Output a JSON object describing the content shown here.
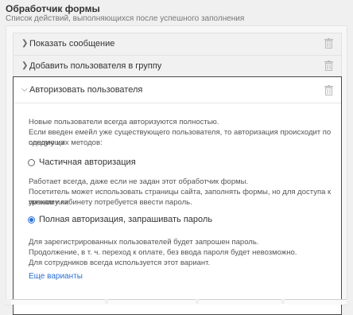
{
  "header": {
    "title": "Обработчик формы",
    "subtitle": "Список действий, выполняющихся после успешного заполнения"
  },
  "actions": [
    {
      "label": "Показать сообщение",
      "expanded": false
    },
    {
      "label": "Добавить пользователя в группу",
      "expanded": false
    },
    {
      "label": "Авторизовать пользователя",
      "expanded": true
    }
  ],
  "auth": {
    "intro_line1": "Новые пользователи всегда авторизуются полностью.",
    "intro_line2": "Если введен емейл уже существующего пользователя, то авторизация происходит по одному из",
    "intro_line3": "следующих методов:",
    "option1_label": "Частичная авторизация",
    "option1_checked": false,
    "option1_desc1": "Работает всегда, даже если не задан этот обработчик формы.",
    "option1_desc2": "Посетитель может использовать страницы сайта, заполнять формы, но для доступа к урокам или",
    "option1_desc3": "личному кабинету потребуется ввести пароль.",
    "option2_label": "Полная авторизация, запрашивать пароль",
    "option2_checked": true,
    "option2_desc1": "Для зарегистрированных пользователей будет запрошен пароль.",
    "option2_desc2": "Продолжение, в т. ч. переход к оплате, без ввода пароля будет невозможно.",
    "option2_desc3": "Для сотрудников всегда используется этот вариант.",
    "more_link": "Еще варианты"
  },
  "colors": {
    "accent": "#2a6fd6",
    "border_active": "#4a4a4a"
  }
}
